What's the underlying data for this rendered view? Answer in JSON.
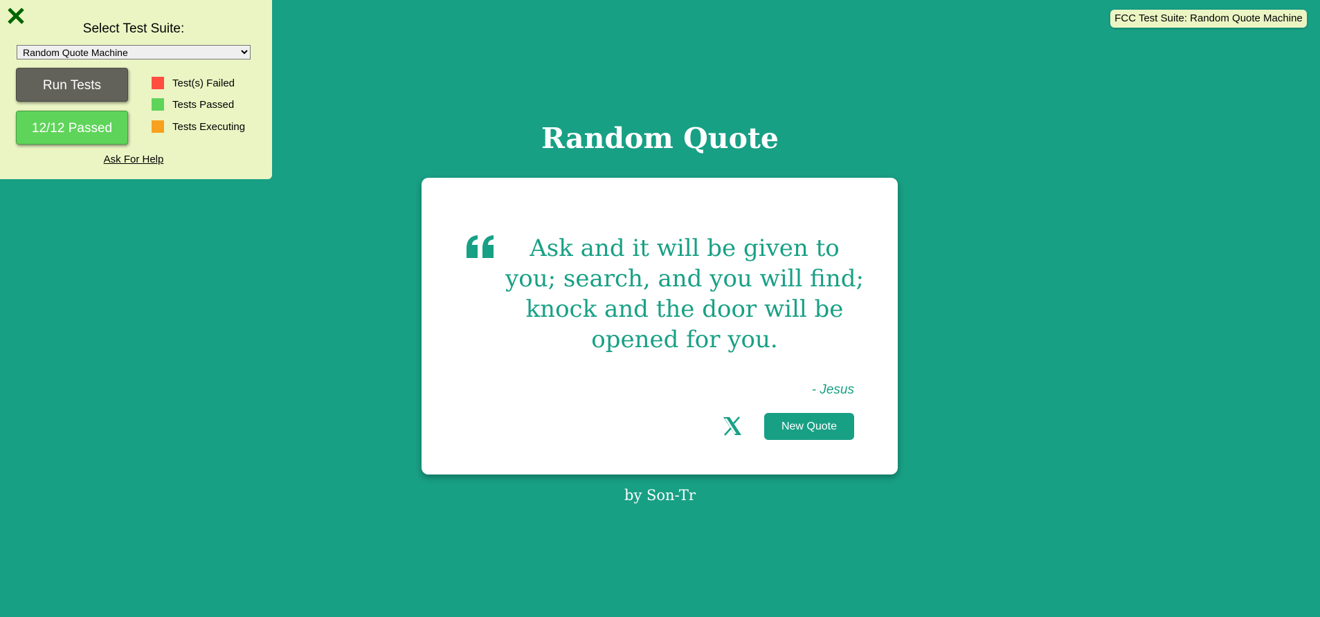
{
  "fcc_panel": {
    "title": "Select Test Suite:",
    "suite_selected": "Random Quote Machine",
    "suite_options": [
      "Random Quote Machine"
    ],
    "run_tests_label": "Run Tests",
    "result_label": "12/12 Passed",
    "legend": [
      {
        "label": "Test(s) Failed",
        "color": "#ff4e3f"
      },
      {
        "label": "Tests Passed",
        "color": "#5fd45a"
      },
      {
        "label": "Tests Executing",
        "color": "#f8a11e"
      }
    ],
    "help_label": "Ask For Help",
    "close_icon": "close-x-icon",
    "close_color": "#006400"
  },
  "fcc_badge": {
    "label": "FCC Test Suite: Random Quote Machine"
  },
  "app": {
    "title": "Random Quote",
    "quote": {
      "text": "Ask and it will be given to you; search, and you will find; knock and the door will be opened for you.",
      "author": "- Jesus",
      "quote_icon": "quote-left-icon"
    },
    "tweet_icon": "x-twitter-icon",
    "new_quote_label": "New Quote",
    "byline": "by Son-Tr",
    "accent_color": "#18a085"
  }
}
